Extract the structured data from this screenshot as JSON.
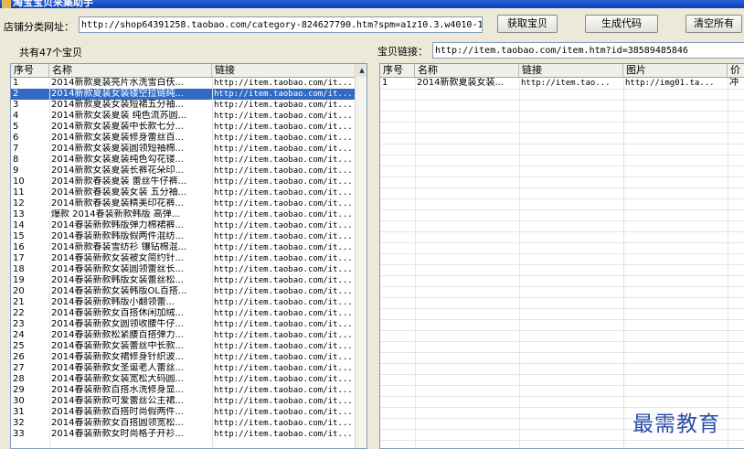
{
  "window": {
    "title": "淘宝宝贝采集助手"
  },
  "top": {
    "url_label": "店铺分类网址：",
    "url_value": "http://shop64391258.taobao.com/category-824627790.htm?spm=a1z10.3.w4010-1626",
    "fetch_button": "获取宝贝",
    "generate_button": "生成代码",
    "clear_button": "清空所有"
  },
  "left": {
    "count_label": "共有47个宝贝",
    "columns": [
      "序号",
      "名称",
      "链接"
    ],
    "selected_row": 2,
    "rows": [
      [
        "1",
        "2014新款夏装亮片水洗雪白仸...",
        "http://item.taobao.com/it..."
      ],
      [
        "2",
        "2014新款夏装女装镂空拉链纯...",
        "http://item.taobao.com/it..."
      ],
      [
        "3",
        "2014新款夏装女装短裙五分袖...",
        "http://item.taobao.com/it..."
      ],
      [
        "4",
        "2014新款女装夏装 纯色流苏圆...",
        "http://item.taobao.com/it..."
      ],
      [
        "5",
        "2014新款女装夏装中长款七分...",
        "http://item.taobao.com/it..."
      ],
      [
        "6",
        "2014新款女装夏装修身蕾丝百...",
        "http://item.taobao.com/it..."
      ],
      [
        "7",
        "2014新款女装夏装圆领短袖棉...",
        "http://item.taobao.com/it..."
      ],
      [
        "8",
        "2014新款女装夏装纯色勾花镂...",
        "http://item.taobao.com/it..."
      ],
      [
        "9",
        "2014新款女装夏装长裤花朵印...",
        "http://item.taobao.com/it..."
      ],
      [
        "10",
        "2014新款春装夏装 蕾丝牛仔裤...",
        "http://item.taobao.com/it..."
      ],
      [
        "11",
        "2014新款春装夏装女装 五分袖...",
        "http://item.taobao.com/it..."
      ],
      [
        "12",
        "2014新款春装夏装精美印花裤...",
        "http://item.taobao.com/it..."
      ],
      [
        "13",
        "爆款 2014春装新款韩版 高弹...",
        "http://item.taobao.com/it..."
      ],
      [
        "14",
        "2014春装新款韩版弹力棉裙裤...",
        "http://item.taobao.com/it..."
      ],
      [
        "15",
        "2014春装新款韩版假两件混纺...",
        "http://item.taobao.com/it..."
      ],
      [
        "16",
        "2014新款春装雪纺衫 镶钻棉混...",
        "http://item.taobao.com/it..."
      ],
      [
        "17",
        "2014春装新款女装被女简约针...",
        "http://item.taobao.com/it..."
      ],
      [
        "18",
        "2014春装新款女装圆领蕾丝长...",
        "http://item.taobao.com/it..."
      ],
      [
        "19",
        "2014春装新款韩版女装蕾丝松...",
        "http://item.taobao.com/it..."
      ],
      [
        "20",
        "2014春装新款女装韩版OL百搭...",
        "http://item.taobao.com/it..."
      ],
      [
        "21",
        "2014春装新款韩版小翻领蕾...",
        "http://item.taobao.com/it..."
      ],
      [
        "22",
        "2014春装新款女百搭休闲加绒...",
        "http://item.taobao.com/it..."
      ],
      [
        "23",
        "2014春装新款女圆领收腰牛仔...",
        "http://item.taobao.com/it..."
      ],
      [
        "24",
        "2014春装新款松紧腰百搭弹力...",
        "http://item.taobao.com/it..."
      ],
      [
        "25",
        "2014春装新款女装蕾丝中长款...",
        "http://item.taobao.com/it..."
      ],
      [
        "26",
        "2014春装新款女裙修身针织波...",
        "http://item.taobao.com/it..."
      ],
      [
        "27",
        "2014春装新款女圣诞老人蕾丝...",
        "http://item.taobao.com/it..."
      ],
      [
        "28",
        "2014春装新款女装宽松大码圆...",
        "http://item.taobao.com/it..."
      ],
      [
        "29",
        "2014春装新款百搭水洗修身显...",
        "http://item.taobao.com/it..."
      ],
      [
        "30",
        "2014春装新款可爱蕾丝公主裙...",
        "http://item.taobao.com/it..."
      ],
      [
        "31",
        "2014春装新款百搭时尚假两件...",
        "http://item.taobao.com/it..."
      ],
      [
        "32",
        "2014春装新款女百搭圆领宽松...",
        "http://item.taobao.com/it..."
      ],
      [
        "33",
        "2014春装新款女时尚格子开衫...",
        "http://item.taobao.com/it..."
      ]
    ]
  },
  "right": {
    "link_label": "宝贝链接：",
    "link_value": "http://item.taobao.com/item.htm?id=38589485846",
    "columns": [
      "序号",
      "名称",
      "链接",
      "图片",
      "价"
    ],
    "rows": [
      [
        "1",
        "2014新款夏装女装...",
        "http://item.tao...",
        "http://img01.ta...",
        "冲"
      ]
    ]
  },
  "watermark": "最需教育"
}
